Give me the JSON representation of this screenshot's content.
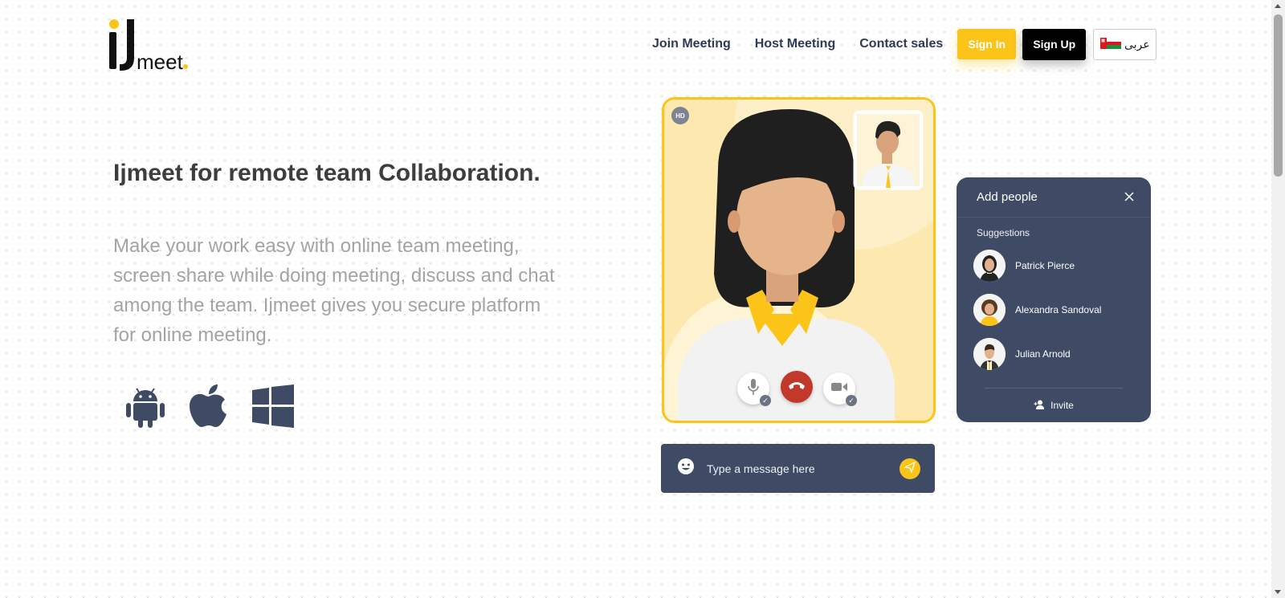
{
  "brand": {
    "logo_mark": "IJ",
    "logo_text": "meet",
    "accent": "#fcc419"
  },
  "nav": {
    "links": [
      "Join Meeting",
      "Host Meeting",
      "Contact sales"
    ],
    "signin": "Sign In",
    "signup": "Sign Up",
    "language": "عربى",
    "language_flag": "oman-flag-icon"
  },
  "hero": {
    "title": "Ijmeet for remote team Collaboration.",
    "description": "Make your work easy with online team meeting, screen share while doing meeting, discuss and chat among the team. Ijmeet gives you secure platform for online meeting.",
    "platforms": [
      "android-icon",
      "apple-icon",
      "windows-icon"
    ]
  },
  "video": {
    "badge": "HD",
    "controls": [
      "microphone-icon",
      "end-call-icon",
      "camera-icon"
    ]
  },
  "chat": {
    "placeholder": "Type a message here"
  },
  "people_panel": {
    "title": "Add people",
    "suggestions_label": "Suggestions",
    "suggestions": [
      {
        "name": "Patrick Pierce"
      },
      {
        "name": "Alexandra Sandoval"
      },
      {
        "name": "Julian Arnold"
      }
    ],
    "invite": "Invite"
  },
  "colors": {
    "panel": "#3f4b65",
    "yellow": "#fcc419",
    "end_call": "#c0392b"
  }
}
